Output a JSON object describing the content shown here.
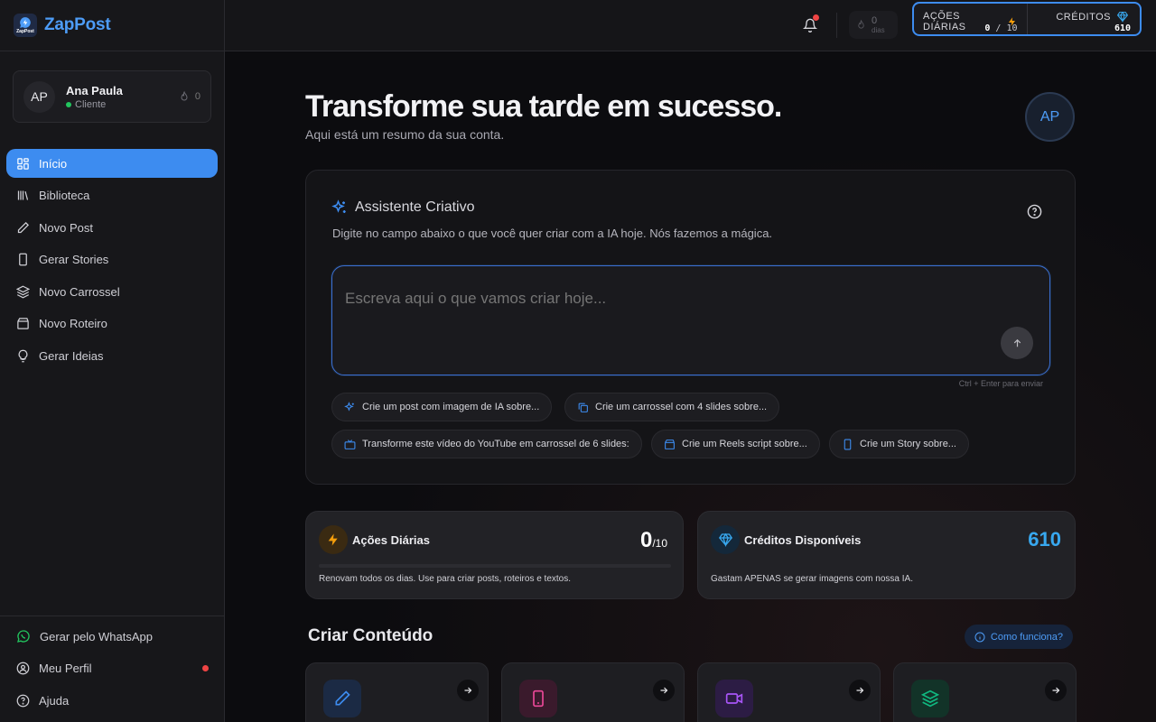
{
  "brand": {
    "name": "ZapPost",
    "logo_text": "ZapPost"
  },
  "profile": {
    "initials": "AP",
    "name": "Ana Paula",
    "role": "Cliente",
    "streak": "0"
  },
  "nav": [
    {
      "label": "Início",
      "icon": "grid-icon",
      "active": true
    },
    {
      "label": "Biblioteca",
      "icon": "library-icon"
    },
    {
      "label": "Novo Post",
      "icon": "pencil-icon"
    },
    {
      "label": "Gerar Stories",
      "icon": "phone-icon"
    },
    {
      "label": "Novo Carrossel",
      "icon": "layers-icon"
    },
    {
      "label": "Novo Roteiro",
      "icon": "clapperboard-icon"
    },
    {
      "label": "Gerar Ideias",
      "icon": "lightbulb-icon"
    }
  ],
  "nav_bottom": [
    {
      "label": "Gerar pelo WhatsApp",
      "icon": "whatsapp-icon"
    },
    {
      "label": "Meu Perfil",
      "icon": "user-circle-icon"
    },
    {
      "label": "Ajuda",
      "icon": "help-circle-icon"
    }
  ],
  "topbar": {
    "streak_value": "0",
    "streak_label": "dias",
    "daily_actions_label": "AÇÕES DIÁRIAS",
    "daily_actions_used": "0",
    "daily_actions_sep": "/",
    "daily_actions_total": "10",
    "credits_label": "CRÉDITOS",
    "credits_value": "610"
  },
  "hero": {
    "title": "Transforme sua tarde em sucesso.",
    "subtitle": "Aqui está um resumo da sua conta.",
    "avatar": "AP"
  },
  "assistant": {
    "title": "Assistente Criativo",
    "description": "Digite no campo abaixo o que você quer criar com a IA hoje. Nós fazemos a mágica.",
    "placeholder": "Escreva aqui o que vamos criar hoje...",
    "hint": "Ctrl + Enter para enviar",
    "chips": [
      {
        "label": "Crie um post com imagem de IA sobre...",
        "icon": "sparkles-icon"
      },
      {
        "label": "Crie um carrossel com 4 slides sobre...",
        "icon": "copy-icon"
      },
      {
        "label": "Transforme este vídeo do YouTube em carrossel de 6 slides:",
        "icon": "tv-icon"
      },
      {
        "label": "Crie um Reels script sobre...",
        "icon": "clapperboard-icon"
      },
      {
        "label": "Crie um Story sobre...",
        "icon": "phone-icon"
      }
    ]
  },
  "cards": {
    "actions": {
      "title": "Ações Diárias",
      "value": "0",
      "total": "/10",
      "description": "Renovam todos os dias. Use para criar posts, roteiros e textos.",
      "progress": 0
    },
    "credits": {
      "title": "Créditos Disponíveis",
      "value": "610",
      "description": "Gastam APENAS se gerar imagens com nossa IA."
    }
  },
  "create": {
    "title": "Criar Conteúdo",
    "how_label": "Como funciona?",
    "items": [
      {
        "icon": "pencil-icon",
        "color": "#3d8cf0"
      },
      {
        "icon": "phone-icon",
        "color": "#ec4899"
      },
      {
        "icon": "video-icon",
        "color": "#a855f7"
      },
      {
        "icon": "layers-icon",
        "color": "#10b981"
      }
    ]
  },
  "colors": {
    "accent": "#3d8cf0",
    "credits": "#38a8ef",
    "alert": "#ef4444",
    "online": "#22c55e",
    "bolt": "#f59e0b"
  }
}
